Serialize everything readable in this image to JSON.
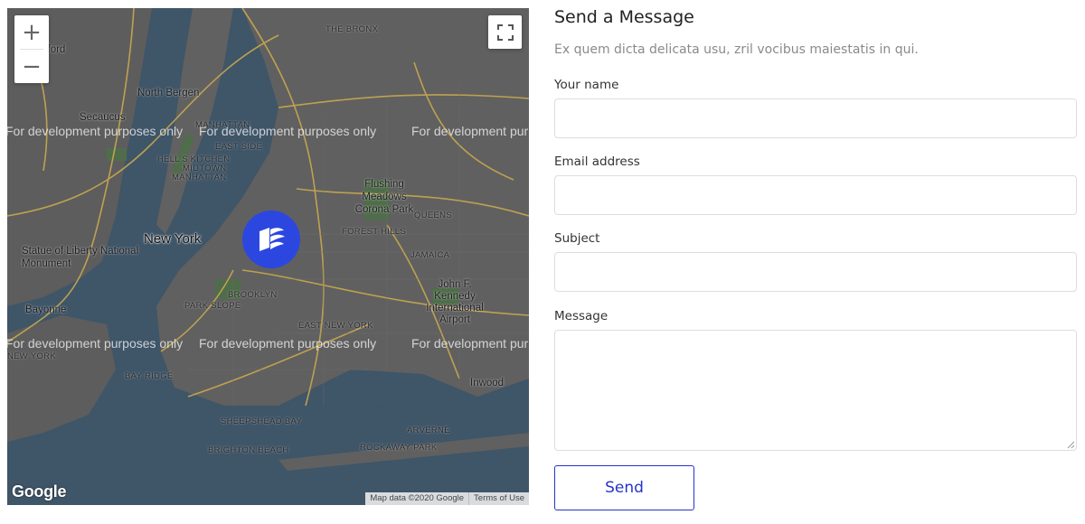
{
  "map": {
    "zoom_in_label": "+",
    "zoom_out_label": "−",
    "watermark_text": "For development purposes only",
    "places": {
      "new_york": "New York",
      "north_bergen": "North Bergen",
      "secaucus": "Secaucus",
      "rutherford": "Rutherford",
      "manhattan": "MANHATTAN",
      "east_side": "EAST SIDE",
      "hells_kitchen": "HELL'S KITCHEN",
      "midtown": "MIDTOWN",
      "manhattan_lower": "MANHATTAN",
      "bronx": "THE BRONX",
      "flushing_meadows": "Flushing Meadows Corona Park",
      "queens": "QUEENS",
      "forest_hills": "FOREST HILLS",
      "jamaica": "JAMAICA",
      "statue_of_liberty": "Statue of Liberty National Monument",
      "brooklyn": "BROOKLYN",
      "park_slope": "PARK SLOPE",
      "bayonne": "Bayonne",
      "east_new_york": "EAST NEW YORK",
      "jfk": "John F. Kennedy International Airport",
      "bay_ridge": "BAY RIDGE",
      "sheepshead_bay": "SHEEPSHEAD BAY",
      "brighton_beach": "BRIGHTON BEACH",
      "rockaway_park": "ROCKAWAY PARK",
      "inwood": "Inwood",
      "arverne": "ARVERNE",
      "new_york_small": "NEW YORK"
    },
    "logo": "Google",
    "attribution": "Map data ©2020 Google",
    "terms": "Terms of Use",
    "colors": {
      "marker": "#2c47e0",
      "water": "#44586a"
    }
  },
  "form": {
    "title": "Send a Message",
    "subtitle": "Ex quem dicta delicata usu, zril vocibus maiestatis in qui.",
    "name_label": "Your name",
    "name_value": "",
    "email_label": "Email address",
    "email_value": "",
    "subject_label": "Subject",
    "subject_value": "",
    "message_label": "Message",
    "message_value": "",
    "send_label": "Send",
    "colors": {
      "accent": "#2633c9"
    }
  }
}
